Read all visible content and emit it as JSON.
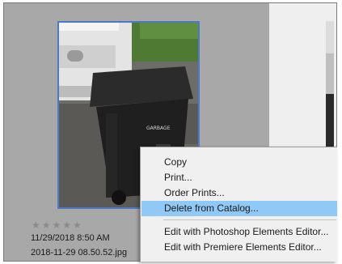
{
  "photo": {
    "rating_stars": "★★★★★",
    "date_taken": "11/29/2018 8:50 AM",
    "filename": "2018-11-29 08.50.52.jpg",
    "colors": {
      "selection_border": "#4f79c7",
      "star_color": "#8a8a8a"
    }
  },
  "context_menu": {
    "items": [
      {
        "label": "Copy"
      },
      {
        "label": "Print..."
      },
      {
        "label": "Order Prints..."
      },
      {
        "label": "Delete from Catalog...",
        "highlighted": true
      },
      {
        "label": "Edit with Photoshop Elements Editor..."
      },
      {
        "label": "Edit with Premiere Elements Editor..."
      }
    ],
    "highlight_color": "#90c8f6"
  }
}
